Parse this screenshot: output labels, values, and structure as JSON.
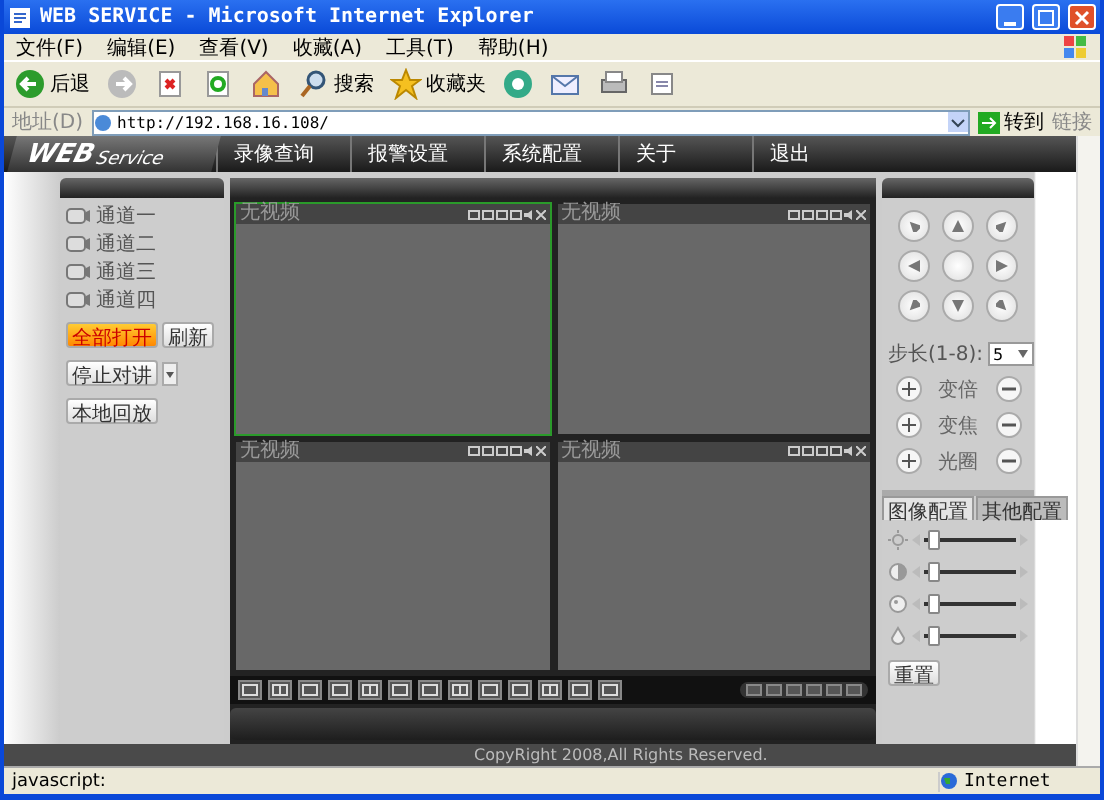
{
  "window": {
    "title": "WEB SERVICE - Microsoft Internet Explorer"
  },
  "menu": [
    "文件(F)",
    "编辑(E)",
    "查看(V)",
    "收藏(A)",
    "工具(T)",
    "帮助(H)"
  ],
  "toolbar": [
    {
      "kind": "back",
      "label": "后退"
    },
    {
      "kind": "forward"
    },
    {
      "kind": "stop"
    },
    {
      "kind": "refresh"
    },
    {
      "kind": "home"
    },
    {
      "kind": "search",
      "label": "搜索"
    },
    {
      "kind": "favorites",
      "label": "收藏夹"
    },
    {
      "kind": "media"
    },
    {
      "kind": "mail"
    },
    {
      "kind": "print"
    },
    {
      "kind": "edit"
    }
  ],
  "address": {
    "label": "地址(D)",
    "url": "http://192.168.16.108/",
    "go": "转到",
    "links": "链接"
  },
  "app": {
    "logo_main": "WEB",
    "logo_sub": "Service",
    "nav": [
      "录像查询",
      "报警设置",
      "系统配置",
      "关于",
      "退出"
    ]
  },
  "channels": [
    "通道一",
    "通道二",
    "通道三",
    "通道四"
  ],
  "open_all": "全部打开",
  "refresh": "刷新",
  "talk": "停止对讲",
  "playback": "本地回放",
  "videos": [
    {
      "title": "无视频",
      "selected": true
    },
    {
      "title": "无视频",
      "selected": false
    },
    {
      "title": "无视频",
      "selected": false
    },
    {
      "title": "无视频",
      "selected": false
    }
  ],
  "ptz": {
    "step_label": "步长(1-8):",
    "step": "5",
    "controls": [
      "变倍",
      "变焦",
      "光圈"
    ]
  },
  "image_tabs": [
    {
      "label": "图像配置",
      "selected": true
    },
    {
      "label": "其他配置",
      "selected": false
    }
  ],
  "image_sliders": [
    {
      "kind": "brightness",
      "level": 0.05
    },
    {
      "kind": "contrast",
      "level": 0.05
    },
    {
      "kind": "saturation",
      "level": 0.05
    },
    {
      "kind": "hue",
      "level": 0.05
    }
  ],
  "reset": "重置",
  "copyright": "CopyRight 2008,All Rights Reserved.",
  "status": {
    "text": "javascript:",
    "zone": "Internet"
  }
}
